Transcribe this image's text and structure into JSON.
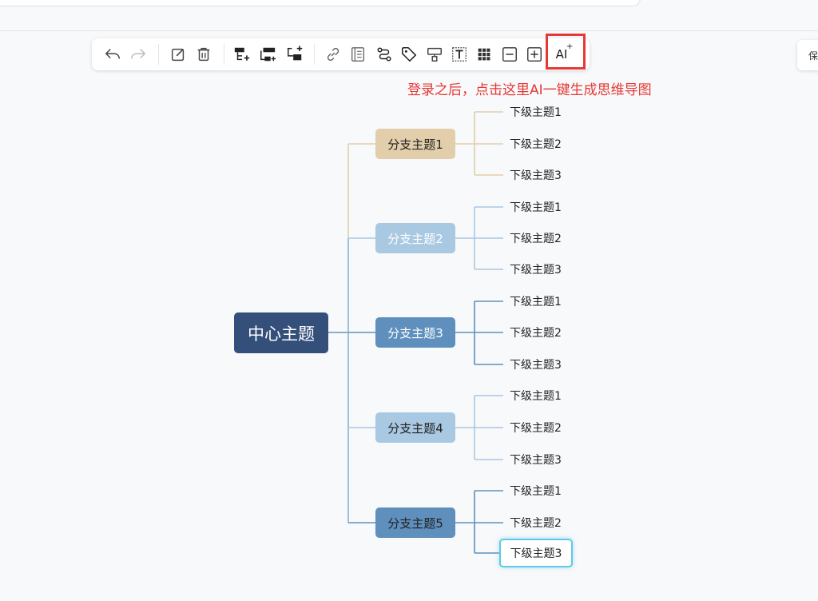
{
  "toolbar": {
    "buttons": [
      {
        "name": "undo-button",
        "icon": "undo-icon"
      },
      {
        "name": "redo-button",
        "icon": "redo-icon"
      },
      {
        "name": "edit-button",
        "icon": "edit-icon"
      },
      {
        "name": "delete-button",
        "icon": "trash-icon"
      },
      {
        "name": "insert-sibling-button",
        "icon": "insert-sibling-icon"
      },
      {
        "name": "insert-parent-button",
        "icon": "insert-parent-icon"
      },
      {
        "name": "insert-child-button",
        "icon": "insert-child-icon"
      },
      {
        "name": "link-button",
        "icon": "link-icon"
      },
      {
        "name": "note-button",
        "icon": "note-icon"
      },
      {
        "name": "relation-button",
        "icon": "relation-icon"
      },
      {
        "name": "tag-button",
        "icon": "tag-icon"
      },
      {
        "name": "format-painter-button",
        "icon": "paint-roller-icon"
      },
      {
        "name": "text-button",
        "icon": "text-box-icon"
      },
      {
        "name": "grid-button",
        "icon": "grid-icon"
      },
      {
        "name": "collapse-button",
        "icon": "minus-box-icon"
      },
      {
        "name": "expand-button",
        "icon": "plus-box-icon"
      },
      {
        "name": "ai-button",
        "icon": "ai-sparkle-icon"
      }
    ],
    "ai_label": "AI",
    "ai_sparkle": "+"
  },
  "annotation": "登录之后，点击这里AI一键生成思维导图",
  "side_button_label": "保",
  "colors": {
    "center": "#344f7a",
    "branch1": "#e2ceaa",
    "branch2": "#a9c8e2",
    "branch3": "#5e8fbd",
    "branch4": "#a9c8e2",
    "branch5": "#5e8fbd",
    "annotation_red": "#e53935",
    "selected_border": "#63c8e6"
  },
  "mindmap": {
    "center": "中心主题",
    "branches": [
      {
        "label": "分支主题1",
        "children": [
          "下级主题1",
          "下级主题2",
          "下级主题3"
        ]
      },
      {
        "label": "分支主题2",
        "children": [
          "下级主题1",
          "下级主题2",
          "下级主题3"
        ]
      },
      {
        "label": "分支主题3",
        "children": [
          "下级主题1",
          "下级主题2",
          "下级主题3"
        ]
      },
      {
        "label": "分支主题4",
        "children": [
          "下级主题1",
          "下级主题2",
          "下级主题3"
        ]
      },
      {
        "label": "分支主题5",
        "children": [
          "下级主题1",
          "下级主题2",
          "下级主题3"
        ]
      }
    ]
  }
}
